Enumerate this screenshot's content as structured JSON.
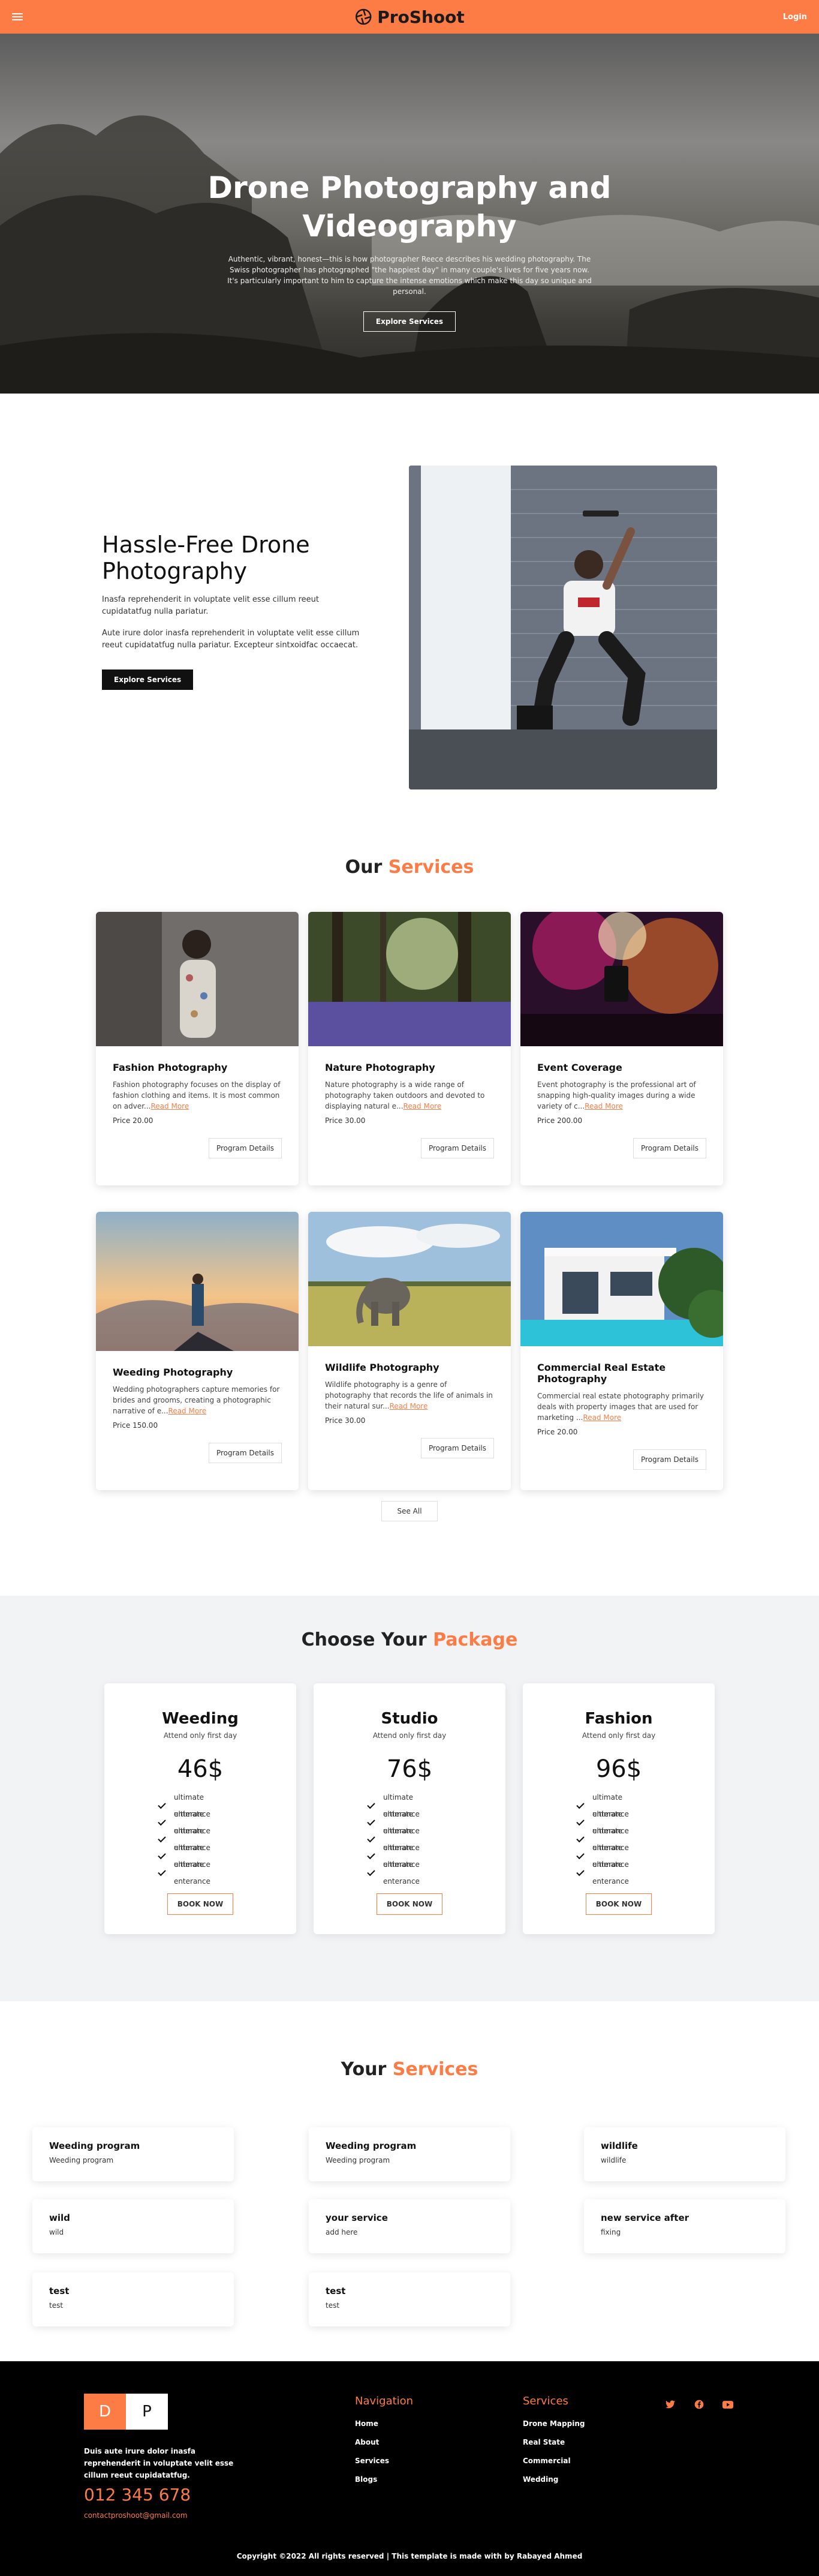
{
  "nav": {
    "brand": "ProShoot",
    "login": "Login",
    "accent": "#fd7c45"
  },
  "hero": {
    "title": "Drone Photography and Videography",
    "text": "Authentic, vibrant, honest—this is how photographer Reece describes his wedding photography. The Swiss photographer has photographed \"the happiest day\" in many couple's lives for five years now. It's particularly important to him to capture the intense emotions which make this day so unique and personal.",
    "button": "Explore Services"
  },
  "about": {
    "title": "Hassle-Free Drone Photography",
    "p1": "Inasfa reprehenderit in voluptate velit esse cillum reeut cupidatatfug nulla pariatur.",
    "p2": "Aute irure dolor inasfa reprehenderit in voluptate velit esse cillum reeut cupidatatfug nulla pariatur. Excepteur sintxoidfac occaecat.",
    "button": "Explore Services"
  },
  "services_section": {
    "title_a": "Our",
    "title_b": "Services",
    "see_all": "See All"
  },
  "services": [
    {
      "title": "Fashion Photography",
      "desc": "Fashion photography focuses on the display of fashion clothing and items. It is most common on adver...",
      "more": "Read More",
      "price": "Price 20.00",
      "button": "Program Details"
    },
    {
      "title": "Nature Photography",
      "desc": "Nature photography is a wide range of photography taken outdoors and devoted to displaying natural e...",
      "more": "Read More",
      "price": "Price 30.00",
      "button": "Program Details"
    },
    {
      "title": "Event Coverage",
      "desc": "Event photography is the professional art of snapping high-quality images during a wide variety of c...",
      "more": "Read More",
      "price": "Price 200.00",
      "button": "Program Details"
    },
    {
      "title": "Weeding Photography",
      "desc": "Wedding photographers capture memories for brides and grooms, creating a photographic narrative of e...",
      "more": "Read More",
      "price": "Price 150.00",
      "button": "Program Details"
    },
    {
      "title": "Wildlife Photography",
      "desc": "Wildlife photography is a genre of photography that records the life of animals in their natural sur...",
      "more": "Read More",
      "price": "Price 30.00",
      "button": "Program Details"
    },
    {
      "title": "Commercial Real Estate Photography",
      "desc": "Commercial real estate photography primarily deals with property images that are used for marketing ...",
      "more": "Read More",
      "price": "Price 20.00",
      "button": "Program Details"
    }
  ],
  "package_section": {
    "title_a": "Choose Your",
    "title_b": "Package"
  },
  "packages": [
    {
      "name": "Weeding",
      "sub": "Attend only first day",
      "price": "46$",
      "features": [
        "ultimate enterance",
        "ultimate enterance",
        "ultimate enterance",
        "ultimate enterance",
        "ultimate enterance"
      ],
      "button": "BOOK NOW"
    },
    {
      "name": "Studio",
      "sub": "Attend only first day",
      "price": "76$",
      "features": [
        "ultimate enterance",
        "ultimate enterance",
        "ultimate enterance",
        "ultimate enterance",
        "ultimate enterance"
      ],
      "button": "BOOK NOW"
    },
    {
      "name": "Fashion",
      "sub": "Attend only first day",
      "price": "96$",
      "features": [
        "ultimate enterance",
        "ultimate enterance",
        "ultimate enterance",
        "ultimate enterance",
        "ultimate enterance"
      ],
      "button": "BOOK NOW"
    }
  ],
  "your_services_section": {
    "title_a": "Your",
    "title_b": "Services"
  },
  "your_services": [
    {
      "title": "Weeding program",
      "desc": "Weeding program"
    },
    {
      "title": "Weeding program",
      "desc": "Weeding program"
    },
    {
      "title": "wildlife",
      "desc": "wildlife"
    },
    {
      "title": "wild",
      "desc": "wild"
    },
    {
      "title": "your service",
      "desc": "add here"
    },
    {
      "title": "new service after",
      "desc": "fixing"
    },
    {
      "title": "test",
      "desc": "test"
    },
    {
      "title": "test",
      "desc": "test"
    }
  ],
  "footer": {
    "logo_a": "D",
    "logo_b": "P",
    "about": "Duis aute irure dolor inasfa reprehenderit in voluptate velit esse cillum reeut cupidatatfug.",
    "phone": "012 345 678",
    "email": "contactproshoot@gmail.com",
    "nav_title": "Navigation",
    "nav_items": [
      "Home",
      "About",
      "Services",
      "Blogs"
    ],
    "svc_title": "Services",
    "svc_items": [
      "Drone Mapping",
      "Real State",
      "Commercial",
      "Wedding"
    ],
    "social_icons": [
      "twitter-icon",
      "facebook-icon",
      "youtube-icon"
    ],
    "copyright": "Copyright ©2022 All rights reserved | This template is made with by Rabayed Ahmed"
  }
}
